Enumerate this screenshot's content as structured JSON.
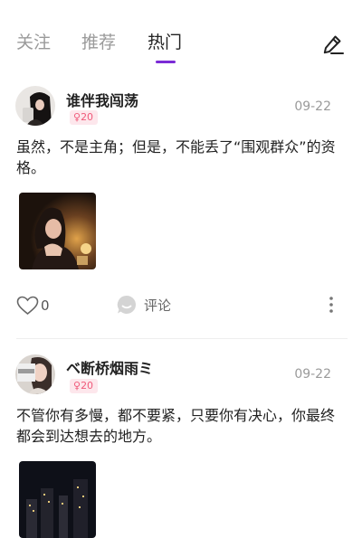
{
  "tabs": [
    {
      "label": "关注"
    },
    {
      "label": "推荐"
    },
    {
      "label": "热门"
    }
  ],
  "active_tab": 2,
  "colors": {
    "accent": "#7b2bd6",
    "badge_text": "#f05a7a",
    "badge_bg": "#fde7ec",
    "muted": "#9a9a9a"
  },
  "icons": {
    "compose": "edit-pen-icon",
    "like": "heart-outline-icon",
    "comment": "comment-bubble-icon",
    "more": "vertical-ellipsis-icon",
    "gender": "female-icon"
  },
  "posts": [
    {
      "username": "谁伴我闯荡",
      "age": "20",
      "date": "09-22",
      "content": "虽然，不是主角；但是，不能丢了“围观群众”的资格。",
      "likes": "0",
      "comment_label": "评论"
    },
    {
      "username": "ベ断桥烟雨ミ",
      "age": "20",
      "date": "09-22",
      "content": "不管你有多慢，都不要紧，只要你有决心，你最终都会到达想去的地方。"
    }
  ]
}
